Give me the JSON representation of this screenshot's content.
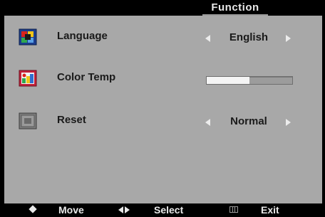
{
  "header": {
    "title": "Function"
  },
  "menu": {
    "items": [
      {
        "label": "Language",
        "icon": "language-icon",
        "control": "selector",
        "value": "English"
      },
      {
        "label": "Color Temp",
        "icon": "color-temp-icon",
        "control": "slider",
        "level": 0.5
      },
      {
        "label": "Reset",
        "icon": "reset-icon",
        "control": "selector",
        "value": "Normal"
      }
    ]
  },
  "footer": {
    "move_icon": "up-down-icon",
    "move_label": "Move",
    "select_icon": "left-right-icon",
    "select_label": "Select",
    "exit_icon": "menu-icon",
    "exit_label": "Exit"
  },
  "colors": {
    "panel": "#a8a8a8",
    "bars": "#000000",
    "text": "#1a1a1a",
    "light_text": "#e8e8e8"
  }
}
